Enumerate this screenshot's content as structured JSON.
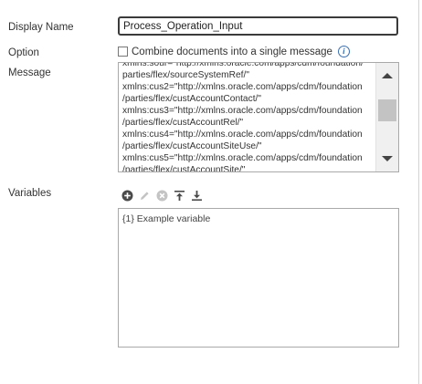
{
  "form": {
    "display_name_label": "Display Name",
    "display_name_value": "Process_Operation_Input",
    "option_label": "Option",
    "option_checkbox_label": "Combine documents into a single message",
    "option_checked": false,
    "message_label": "Message",
    "message_lines": [
      "xmlns:sour=\"http://xmlns.oracle.com/apps/cdm/foundation/",
      "parties/flex/sourceSystemRef/\"",
      "xmlns:cus2=\"http://xmlns.oracle.com/apps/cdm/foundation",
      "/parties/flex/custAccountContact/\"",
      "xmlns:cus3=\"http://xmlns.oracle.com/apps/cdm/foundation",
      "/parties/flex/custAccountRel/\"",
      "xmlns:cus4=\"http://xmlns.oracle.com/apps/cdm/foundation",
      "/parties/flex/custAccountSiteUse/\"",
      "xmlns:cus5=\"http://xmlns.oracle.com/apps/cdm/foundation",
      "/parties/flex/custAccountSite/\""
    ],
    "variables_label": "Variables",
    "variables": [
      "{1} Example variable"
    ]
  },
  "icons": {
    "add": "add-circle-icon",
    "edit": "pencil-icon",
    "remove": "remove-circle-icon",
    "move_top": "move-to-top-icon",
    "move_bottom": "move-to-bottom-icon",
    "info": "info-icon"
  },
  "colors": {
    "info_blue": "#3a6fb0",
    "focus_border": "#3b3b3b",
    "icon_active": "#4a4a4a",
    "icon_disabled": "#c4c4c4"
  }
}
